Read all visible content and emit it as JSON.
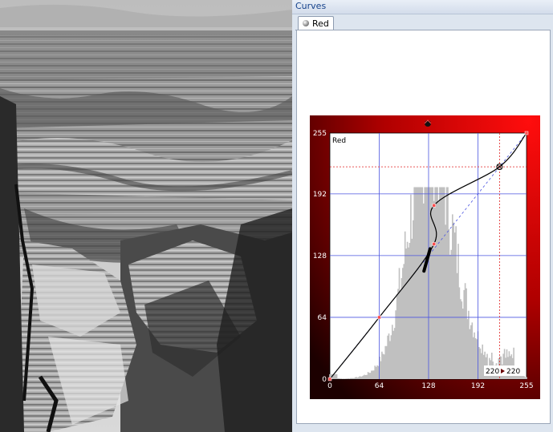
{
  "panel": {
    "title": "Curves",
    "tab_label": "Red"
  },
  "curve": {
    "channel_label": "Red",
    "axis_ticks": [
      0,
      64,
      128,
      192,
      255
    ],
    "input_value": "220",
    "output_value": "220",
    "colors": {
      "frame_outer": "#3a0000",
      "frame_bright": "#e00000",
      "grid": "#4b55e0",
      "histogram": "#c0c0c0",
      "selected_guide": "#e02020"
    },
    "control_points": [
      {
        "in": 0,
        "out": 0
      },
      {
        "in": 64,
        "out": 64
      },
      {
        "in": 135,
        "out": 140
      },
      {
        "in": 135,
        "out": 180
      },
      {
        "in": 220,
        "out": 220
      },
      {
        "in": 255,
        "out": 255
      }
    ],
    "selected_point": {
      "in": 220,
      "out": 220
    }
  }
}
